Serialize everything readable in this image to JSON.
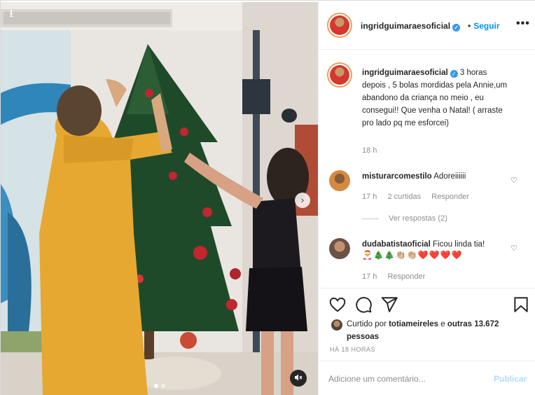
{
  "post": {
    "username": "ingridguimaraesoficial",
    "follow_label": "Seguir",
    "follow_separator": "•",
    "more_label": "•••",
    "verified_mark": "✓"
  },
  "caption": {
    "username": "ingridguimaraesoficial",
    "text": "3 horas depois , 5 bolas mordidas pela Annie,um abandono da criança no meio , eu consegui!! Que venha o Natal! ( arraste pro lado pq me esforcei)",
    "time": "18 h"
  },
  "comments": [
    {
      "username": "misturarcomestilo",
      "text": "Adoreiiiiii",
      "time": "17 h",
      "likes": "2 curtidas",
      "reply_label": "Responder",
      "view_replies": "Ver respostas (2)"
    },
    {
      "username": "dudabatistaoficial",
      "text": "Ficou linda tia!",
      "emojis": "🎅🎄🎄👏🏼👏🏼❤️❤️❤️❤️",
      "time": "17 h",
      "reply_label": "Responder"
    }
  ],
  "likes": {
    "prefix": "Curtido por",
    "user": "totiameireles",
    "connector": "e",
    "others": "outras 13.672 pessoas"
  },
  "post_time": "HÁ 18 HORAS",
  "add_comment": {
    "placeholder": "Adicione um comentário...",
    "publish_label": "Publicar"
  },
  "icons": {
    "download": "download-arrow-icon",
    "next": "chevron-right-icon",
    "mute": "muted-speaker-icon",
    "heart": "heart-icon",
    "comment": "comment-bubble-icon",
    "share": "paper-plane-icon",
    "save": "bookmark-icon"
  },
  "colors": {
    "link_blue": "#0095f6",
    "publish_disabled": "#b3dbff",
    "verified": "#3897f0",
    "muted_text": "#8e8e8e"
  },
  "carousel": {
    "current": 1,
    "total": 2
  }
}
